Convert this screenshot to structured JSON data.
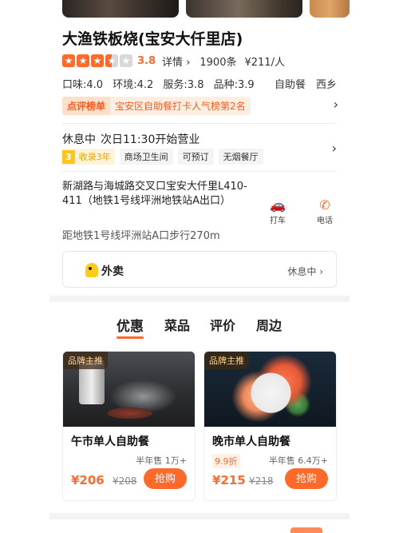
{
  "shop": {
    "name": "大渔铁板烧(宝安大仟里店)",
    "score": "3.8",
    "details_label": "详情",
    "reviews": "1900条",
    "avg_price": "¥211/人",
    "taste": "口味:4.0",
    "environment": "环境:4.2",
    "service": "服务:3.8",
    "variety": "品种:3.9",
    "category": "自助餐",
    "area": "西乡",
    "rank_tag": "点评榜单",
    "rank_text": "宝安区自助餐打卡人气榜第2名",
    "status": "休息中",
    "next_open": "次日11:30开始营业",
    "years_num": "3",
    "years_text": "收录3年",
    "features": [
      "商场卫生间",
      "可预订",
      "无烟餐厅"
    ],
    "address": "新湖路与海城路交叉口宝安大仟里L410-411（地铁1号线坪洲地铁站A出口）",
    "distance": "距地铁1号线坪洲站A口步行270m",
    "taxi_label": "打车",
    "call_label": "电话"
  },
  "delivery": {
    "title": "外卖",
    "status": "休息中"
  },
  "tabs": [
    "优惠",
    "菜品",
    "评价",
    "周边"
  ],
  "deals": [
    {
      "tag": "品牌主推",
      "name": "午市单人自助餐",
      "sold": "半年售 1万+",
      "price": "¥206",
      "original": "¥208",
      "button": "抢购"
    },
    {
      "tag": "品牌主推",
      "name": "晚市单人自助餐",
      "discount": "9.9折",
      "sold": "半年售 6.4万+",
      "price": "¥215",
      "original": "¥218",
      "button": "抢购"
    }
  ],
  "colors": {
    "accent": "#ff6a2b",
    "years": "#ffc41c",
    "taxi": "#2d8fd8"
  }
}
